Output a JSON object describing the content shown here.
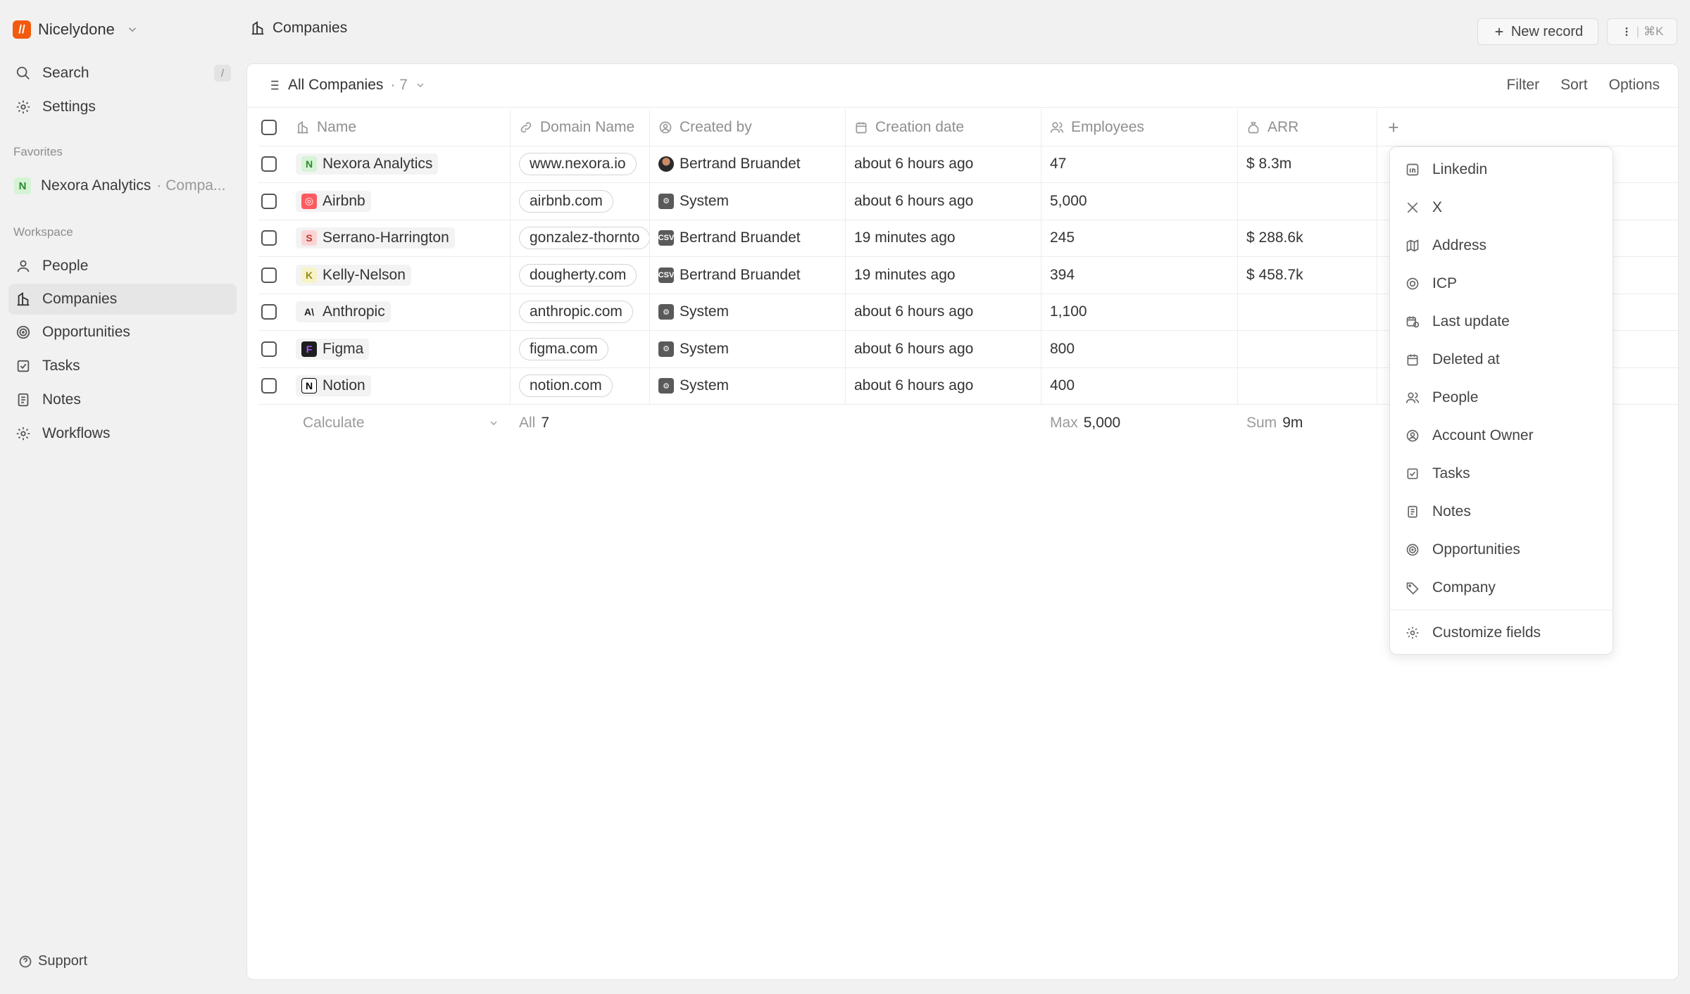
{
  "workspace": {
    "name": "Nicelydone",
    "logo": "//"
  },
  "sidebar": {
    "search_label": "Search",
    "search_kbd": "/",
    "settings_label": "Settings",
    "favorites_label": "Favorites",
    "favorite": {
      "badge": "N",
      "name": "Nexora Analytics",
      "sub": "· Compa..."
    },
    "workspace_label": "Workspace",
    "items": [
      {
        "label": "People",
        "icon": "user-icon"
      },
      {
        "label": "Companies",
        "icon": "building-icon"
      },
      {
        "label": "Opportunities",
        "icon": "target-icon"
      },
      {
        "label": "Tasks",
        "icon": "checkbox-icon"
      },
      {
        "label": "Notes",
        "icon": "note-icon"
      },
      {
        "label": "Workflows",
        "icon": "gear-icon"
      }
    ],
    "support_label": "Support"
  },
  "header": {
    "title": "Companies",
    "new_record_label": "New record",
    "command_hint": "⌘K"
  },
  "view": {
    "name": "All Companies",
    "count": "· 7",
    "filter_label": "Filter",
    "sort_label": "Sort",
    "options_label": "Options"
  },
  "table": {
    "columns": [
      "Name",
      "Domain Name",
      "Created by",
      "Creation date",
      "Employees",
      "ARR"
    ],
    "rows": [
      {
        "name": "Nexora Analytics",
        "badge": "N",
        "badge_bg": "#d5f3d5",
        "badge_fg": "#2b8a2b",
        "domain": "www.nexora.io",
        "created_by": "Bertrand Bruandet",
        "creator_type": "avatar",
        "date": "about 6 hours ago",
        "employees": "47",
        "arr": "$ 8.3m"
      },
      {
        "name": "Airbnb",
        "badge": "◎",
        "badge_bg": "#ff5a5f",
        "badge_fg": "#ffffff",
        "domain": "airbnb.com",
        "created_by": "System",
        "creator_type": "system",
        "date": "about 6 hours ago",
        "employees": "5,000",
        "arr": ""
      },
      {
        "name": "Serrano-Harrington",
        "badge": "S",
        "badge_bg": "#fbd5d5",
        "badge_fg": "#c0392b",
        "domain": "gonzalez-thornto",
        "created_by": "Bertrand Bruandet",
        "creator_type": "csv",
        "date": "19 minutes ago",
        "employees": "245",
        "arr": "$ 288.6k"
      },
      {
        "name": "Kelly-Nelson",
        "badge": "K",
        "badge_bg": "#f7f3c8",
        "badge_fg": "#9a8a10",
        "domain": "dougherty.com",
        "created_by": "Bertrand Bruandet",
        "creator_type": "csv",
        "date": "19 minutes ago",
        "employees": "394",
        "arr": "$ 458.7k"
      },
      {
        "name": "Anthropic",
        "badge": "A\\",
        "badge_bg": "#f3f3f3",
        "badge_fg": "#222222",
        "domain": "anthropic.com",
        "created_by": "System",
        "creator_type": "system",
        "date": "about 6 hours ago",
        "employees": "1,100",
        "arr": ""
      },
      {
        "name": "Figma",
        "badge": "F",
        "badge_bg": "#1e1e1e",
        "badge_fg": "#a259ff",
        "domain": "figma.com",
        "created_by": "System",
        "creator_type": "system",
        "date": "about 6 hours ago",
        "employees": "800",
        "arr": ""
      },
      {
        "name": "Notion",
        "badge": "N",
        "badge_bg": "#ffffff",
        "badge_fg": "#000000",
        "domain": "notion.com",
        "created_by": "System",
        "creator_type": "system",
        "date": "about 6 hours ago",
        "employees": "400",
        "arr": ""
      }
    ],
    "footer": {
      "calculate_label": "Calculate",
      "domain_agg_label": "All",
      "domain_agg_value": "7",
      "employees_agg_label": "Max",
      "employees_agg_value": "5,000",
      "arr_agg_label": "Sum",
      "arr_agg_value": "9m"
    }
  },
  "field_menu": {
    "items": [
      {
        "label": "Linkedin",
        "icon": "linkedin-icon"
      },
      {
        "label": "X",
        "icon": "x-icon"
      },
      {
        "label": "Address",
        "icon": "map-icon"
      },
      {
        "label": "ICP",
        "icon": "target-icon"
      },
      {
        "label": "Last update",
        "icon": "calendar-clock-icon"
      },
      {
        "label": "Deleted at",
        "icon": "calendar-icon"
      },
      {
        "label": "People",
        "icon": "users-icon"
      },
      {
        "label": "Account Owner",
        "icon": "user-circle-icon"
      },
      {
        "label": "Tasks",
        "icon": "checkbox-icon"
      },
      {
        "label": "Notes",
        "icon": "note-icon"
      },
      {
        "label": "Opportunities",
        "icon": "target-icon"
      },
      {
        "label": "Company",
        "icon": "tag-icon"
      }
    ],
    "customize_label": "Customize fields"
  }
}
